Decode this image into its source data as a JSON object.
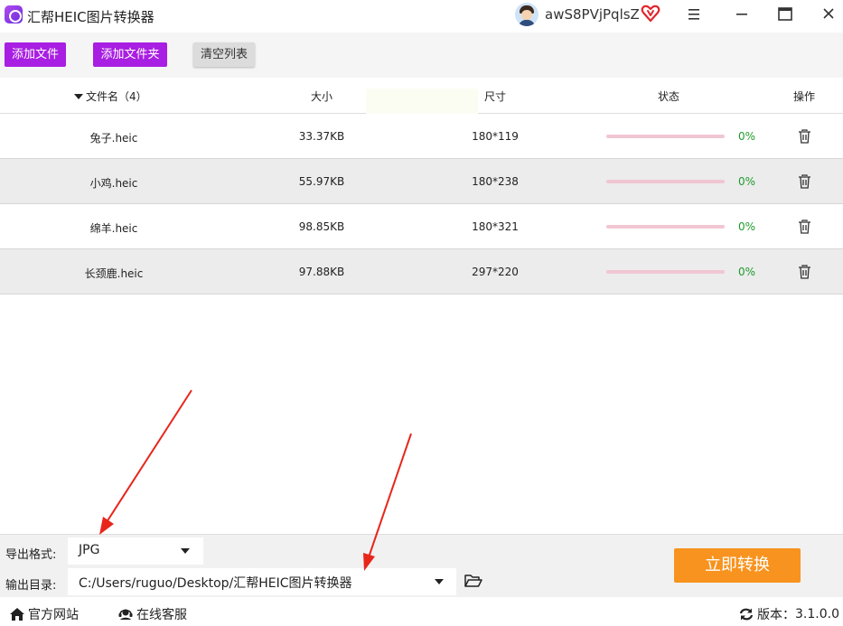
{
  "app": {
    "title": "汇帮HEIC图片转换器",
    "username": "awS8PVjPqlsZ"
  },
  "toolbar": {
    "add_file": "添加文件",
    "add_folder": "添加文件夹",
    "clear_list": "清空列表"
  },
  "table": {
    "headers": {
      "name": "文件名（4）",
      "size": "大小",
      "dimensions": "尺寸",
      "status": "状态",
      "operation": "操作"
    },
    "rows": [
      {
        "name": "兔子.heic",
        "size": "33.37KB",
        "dimensions": "180*119",
        "progress": "0%"
      },
      {
        "name": "小鸡.heic",
        "size": "55.97KB",
        "dimensions": "180*238",
        "progress": "0%"
      },
      {
        "name": "绵羊.heic",
        "size": "98.85KB",
        "dimensions": "180*321",
        "progress": "0%"
      },
      {
        "name": "长颈鹿.heic",
        "size": "97.88KB",
        "dimensions": "297*220",
        "progress": "0%"
      }
    ]
  },
  "settings": {
    "format_label": "导出格式:",
    "format_value": "JPG",
    "dir_label": "输出目录:",
    "dir_value": "C:/Users/ruguo/Desktop/汇帮HEIC图片转换器",
    "convert_button": "立即转换"
  },
  "footer": {
    "website": "官方网站",
    "service": "在线客服",
    "version_label": "版本：",
    "version_value": "3.1.0.0"
  },
  "colors": {
    "purple_button": "#a81ee2",
    "convert_orange": "#f7931e",
    "progress_track": "#f1c6d3",
    "percent_green": "#1f9b2c",
    "annotation_red": "#e8261c"
  },
  "icons": {
    "app_logo": "app-logo-icon",
    "vip": "vip-heart-icon",
    "menu": "hamburger-menu-icon",
    "minimize": "minimize-icon",
    "maximize": "maximize-icon",
    "close": "close-icon",
    "delete": "trash-icon",
    "folder": "folder-open-icon",
    "home": "home-icon",
    "service": "headset-icon",
    "refresh": "refresh-icon"
  }
}
